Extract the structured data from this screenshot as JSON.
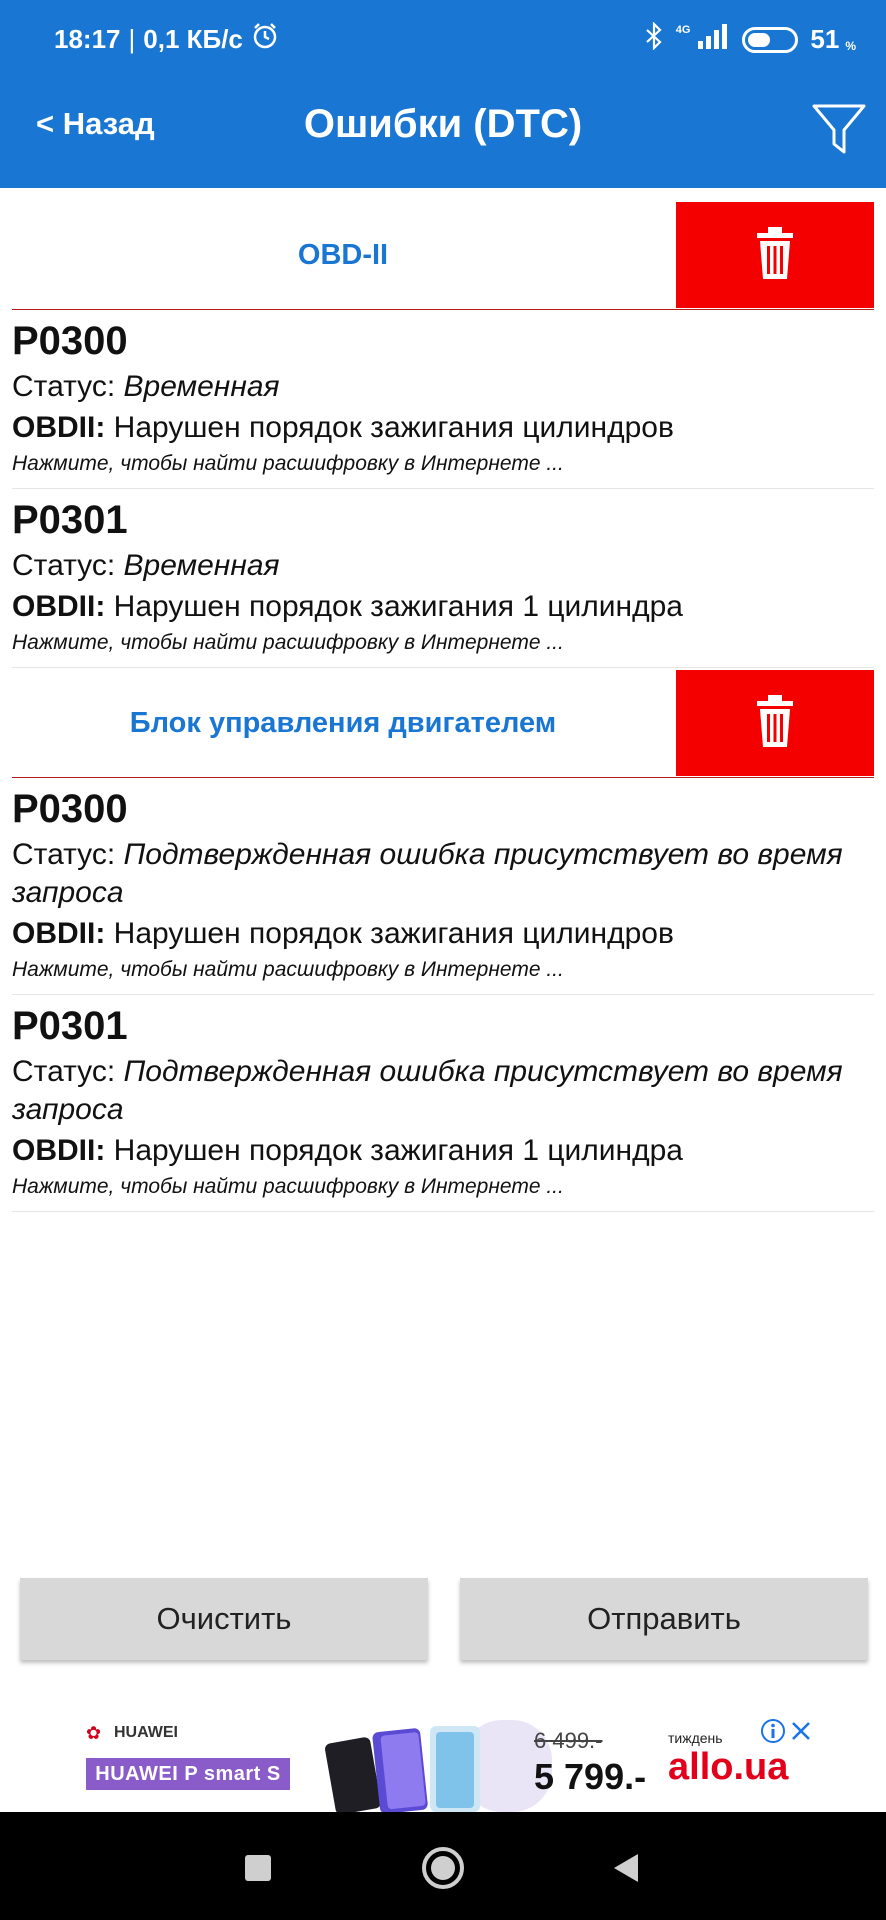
{
  "status_bar": {
    "time": "18:17",
    "separator": "|",
    "speed": "0,1 КБ/с",
    "network": "4G",
    "battery": "51",
    "battery_unit": "%",
    "battery_level": 0.51
  },
  "app_bar": {
    "back_label": "< Назад",
    "title": "Ошибки (DTC)"
  },
  "groups": [
    {
      "title": "OBD-II",
      "items": [
        {
          "code": "P0300",
          "status_label": "Статус: ",
          "status_value": "Временная",
          "desc_prefix": "OBDII:",
          "desc": " Нарушен порядок зажигания цилиндров",
          "hint": "Нажмите, чтобы найти расшифровку в Интернете ..."
        },
        {
          "code": "P0301",
          "status_label": "Статус: ",
          "status_value": "Временная",
          "desc_prefix": "OBDII:",
          "desc": " Нарушен порядок зажигания 1 цилиндра",
          "hint": "Нажмите, чтобы найти расшифровку в Интернете ..."
        }
      ]
    },
    {
      "title": "Блок управления двигателем",
      "items": [
        {
          "code": "P0300",
          "status_label": "Статус: ",
          "status_value": "Подтвержденная ошибка присутствует во время запроса",
          "desc_prefix": "OBDII:",
          "desc": " Нарушен порядок зажигания цилиндров",
          "hint": "Нажмите, чтобы найти расшифровку в Интернете ..."
        },
        {
          "code": "P0301",
          "status_label": "Статус: ",
          "status_value": "Подтвержденная ошибка присутствует во время запроса",
          "desc_prefix": "OBDII:",
          "desc": " Нарушен порядок зажигания 1 цилиндра",
          "hint": "Нажмите, чтобы найти расшифровку в Интернете ..."
        }
      ]
    }
  ],
  "buttons": {
    "clear": "Очистить",
    "send": "Отправить"
  },
  "ad": {
    "brand": "HUAWEI",
    "model": "HUAWEI P smart S",
    "old_price": "6 499.-",
    "new_price": "5 799.-",
    "tagline": "тиждень",
    "store": "allo.ua"
  },
  "colors": {
    "primary": "#1976d2",
    "delete": "#f40000",
    "divider": "#b71c1c"
  },
  "icons": {
    "filter": "filter-icon",
    "delete": "trash-icon",
    "alarm": "alarm-icon",
    "bluetooth": "bluetooth-icon",
    "signal": "signal-icon",
    "battery": "battery-icon",
    "nav_recent": "square-icon",
    "nav_home": "circle-icon",
    "nav_back": "triangle-back-icon"
  }
}
